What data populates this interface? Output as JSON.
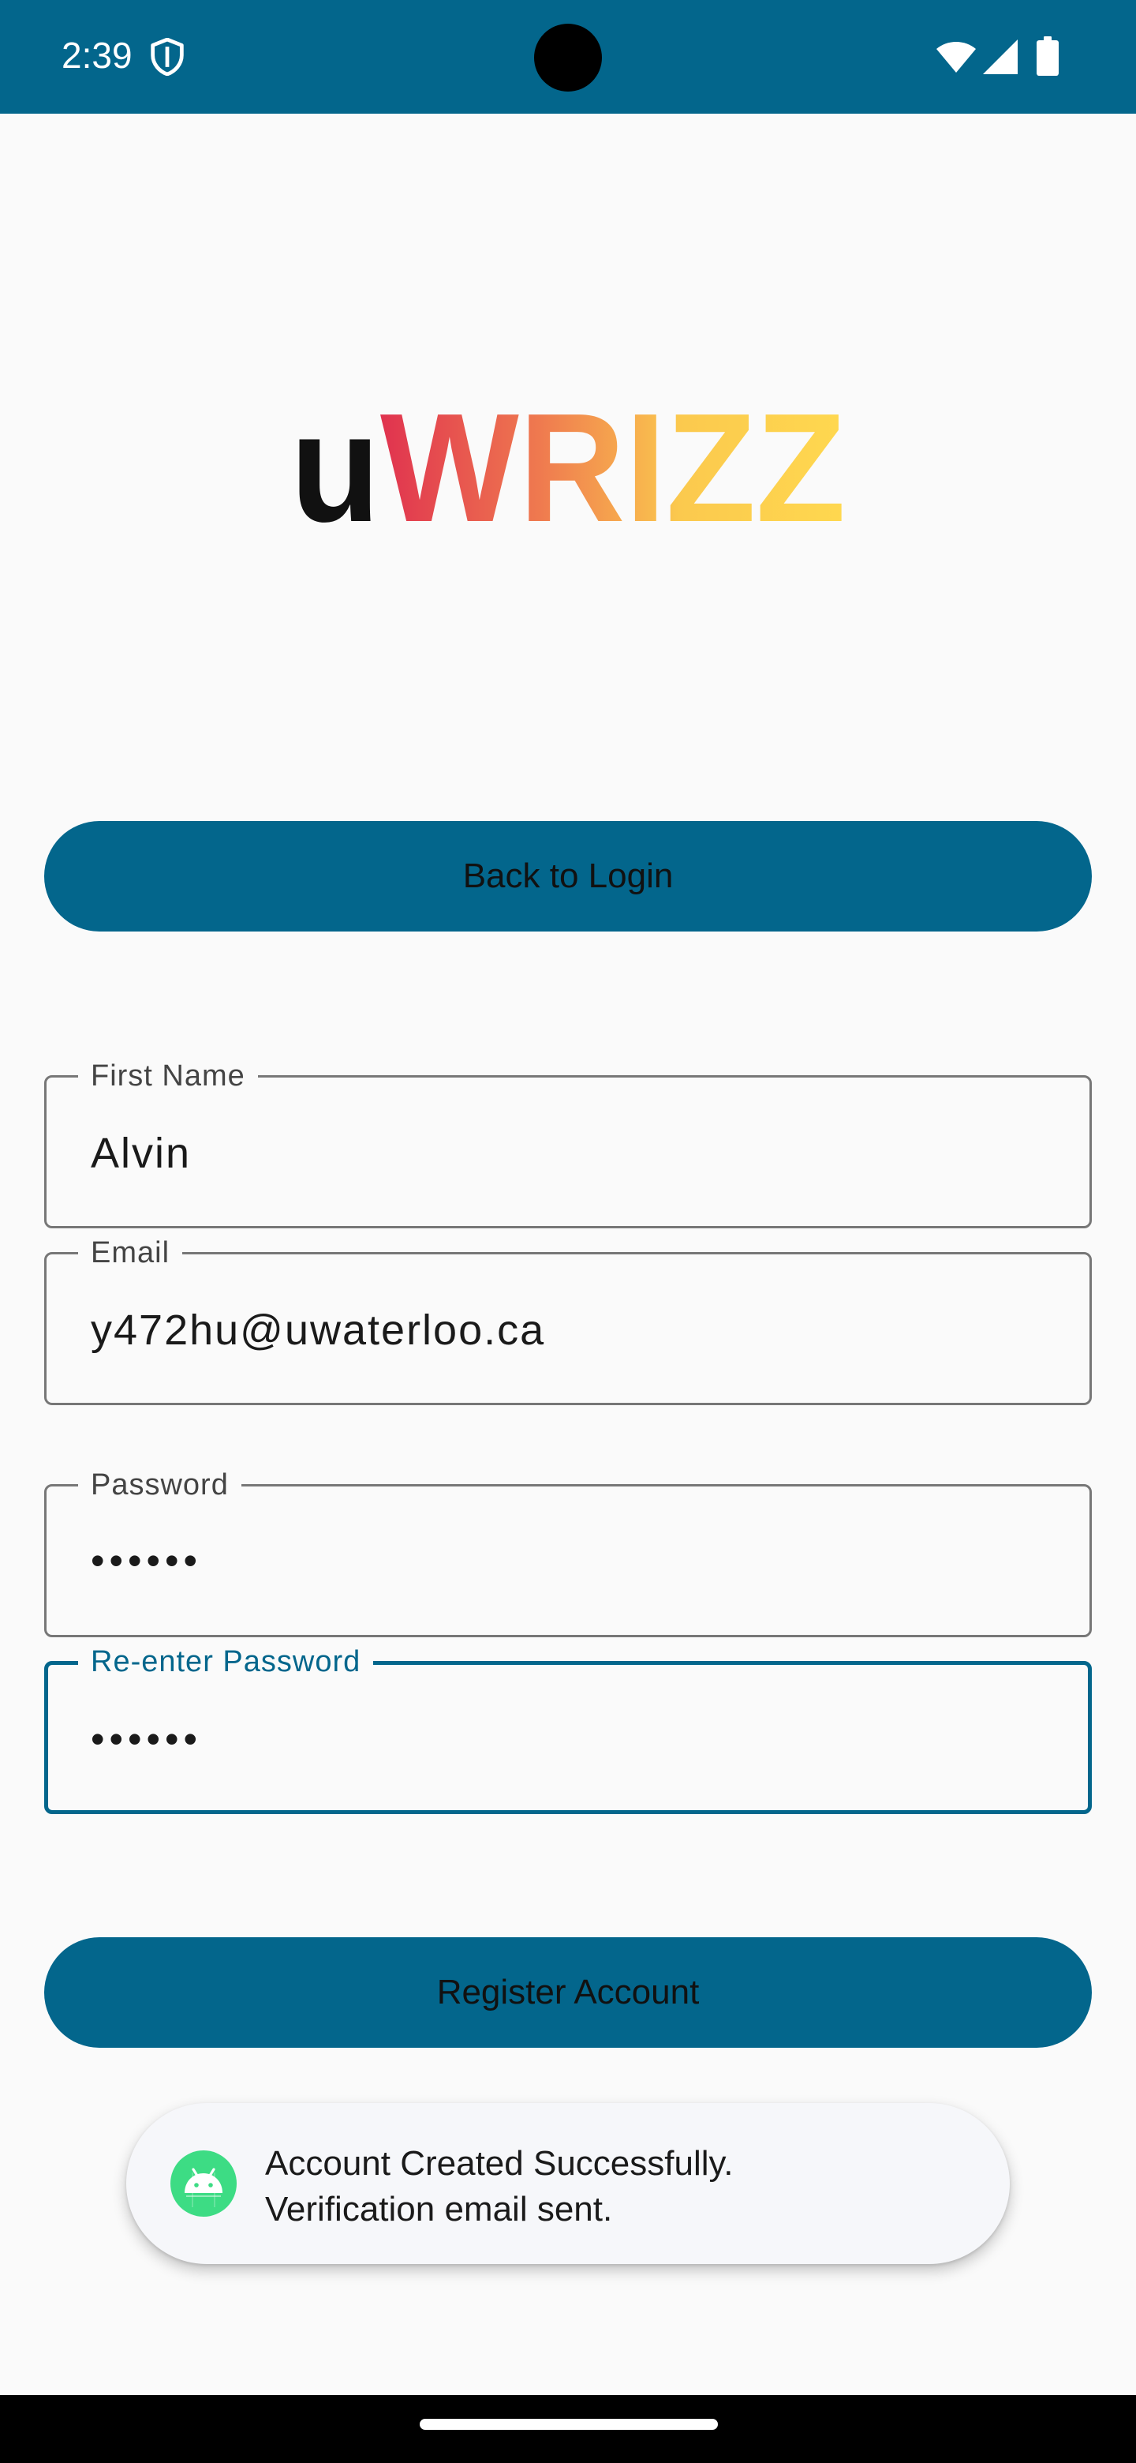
{
  "status_bar": {
    "time": "2:39",
    "icons": [
      "shield-icon",
      "wifi-icon",
      "signal-icon",
      "battery-icon"
    ],
    "background": "#03668c"
  },
  "logo": {
    "text": "uWRIZZ",
    "colors": [
      "#111111",
      "#e0324f",
      "#ef7a4f",
      "#fbc94e",
      "#ffd84f"
    ]
  },
  "back_button": {
    "label": "Back to Login"
  },
  "form": {
    "first_name": {
      "label": "First Name",
      "value": "Alvin"
    },
    "email": {
      "label": "Email",
      "value": "y472hu@uwaterloo.ca"
    },
    "password": {
      "label": "Password",
      "value": "••••••"
    },
    "reenter_password": {
      "label": "Re-enter Password",
      "value": "••••••",
      "focused": true
    }
  },
  "register_button": {
    "label": "Register Account"
  },
  "toast": {
    "icon": "android-icon",
    "line1": "Account Created Successfully.",
    "line2": "Verification email sent."
  },
  "colors": {
    "primary": "#03668c",
    "background": "#fafafa",
    "toast_bg": "#f6f7fa",
    "android_green": "#3ddc84"
  }
}
